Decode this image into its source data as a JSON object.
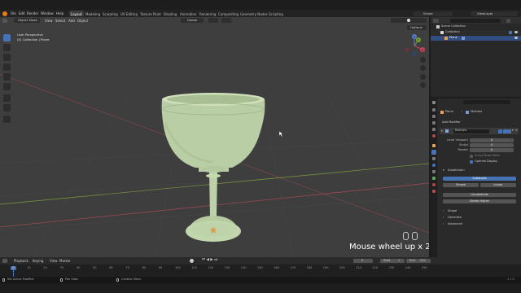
{
  "menu": {
    "items": [
      "File",
      "Edit",
      "Render",
      "Window",
      "Help"
    ],
    "workspaces": [
      "Layout",
      "Modeling",
      "Sculpting",
      "UV Editing",
      "Texture Paint",
      "Shading",
      "Animation",
      "Rendering",
      "Compositing",
      "Geometry Nodes",
      "Scripting"
    ],
    "active_workspace": "Layout",
    "scene": "Scene",
    "view_layer": "ViewLayer"
  },
  "viewport": {
    "mode": "Object Mode",
    "menus": [
      "View",
      "Select",
      "Add",
      "Object"
    ],
    "orientation": "Global",
    "options": "Options",
    "overlay_line1": "User Perspective",
    "overlay_line2": "(0) Collection | Plane",
    "gizmo_z": "Z",
    "gizmo_y": "Y",
    "gizmo_x": "X",
    "caption": "Mouse wheel up x 2"
  },
  "outliner": {
    "root": "Scene Collection",
    "collection": "Collection",
    "object": "Plane"
  },
  "properties": {
    "object_name": "Plane",
    "modifier_tab": "Multires",
    "add_modifier": "Add Modifier",
    "modifier_name": "Multires",
    "fields": [
      {
        "label": "Level Viewport",
        "value": "0"
      },
      {
        "label": "Sculpt",
        "value": "0"
      },
      {
        "label": "Render",
        "value": "0"
      }
    ],
    "sculpt_base_mesh": "Sculpt Base Mesh",
    "optimal_display": "Optimal Display",
    "subdivision_panel": "Subdivision",
    "subdivide": "Subdivide",
    "simple": "Simple",
    "linear": "Linear",
    "unsubdivide": "Unsubdivide",
    "delete_higher": "Delete Higher",
    "shape": "Shape",
    "generate": "Generate",
    "advanced": "Advanced"
  },
  "timeline": {
    "menus": [
      "Playback",
      "Keying",
      "View",
      "Marker"
    ],
    "current_frame": "0",
    "start_label": "Start",
    "start": "1",
    "end_label": "End",
    "end": "250",
    "ticks": [
      "0",
      "10",
      "20",
      "30",
      "40",
      "50",
      "60",
      "70",
      "80",
      "90",
      "100",
      "110",
      "120",
      "130",
      "140",
      "150",
      "160",
      "170",
      "180",
      "190",
      "200",
      "210",
      "220",
      "230",
      "240",
      "250"
    ]
  },
  "status": {
    "left": "Set Active Modifier",
    "mid1": "Pan View",
    "mid2": "Context Menu",
    "version": "3.1.0"
  },
  "colors": {
    "accent": "#4772b3",
    "goblet": "#c2d6ad",
    "viewport_bg": "#3e3e3e",
    "x_axis": "#9c4a52",
    "y_axis": "#7c9a3c"
  }
}
